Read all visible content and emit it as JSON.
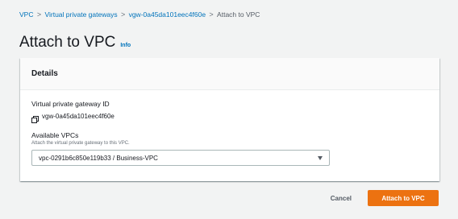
{
  "breadcrumb": {
    "items": [
      {
        "label": "VPC"
      },
      {
        "label": "Virtual private gateways"
      },
      {
        "label": "vgw-0a45da101eec4f60e"
      },
      {
        "label": "Attach to VPC"
      }
    ],
    "separator": ">"
  },
  "header": {
    "title": "Attach to VPC",
    "info_label": "Info"
  },
  "details": {
    "title": "Details",
    "gateway_id_label": "Virtual private gateway ID",
    "gateway_id_value": "vgw-0a45da101eec4f60e",
    "vpcs_label": "Available VPCs",
    "vpcs_description": "Attach the virtual private gateway to this VPC.",
    "vpcs_selected": "vpc-0291b6c850e119b33 / Business-VPC"
  },
  "actions": {
    "cancel_label": "Cancel",
    "submit_label": "Attach to VPC"
  },
  "icons": {
    "copy": "copy-icon",
    "caret": "caret-down-icon"
  },
  "colors": {
    "link": "#0073bb",
    "primary": "#ec7211",
    "background": "#f2f3f3"
  }
}
